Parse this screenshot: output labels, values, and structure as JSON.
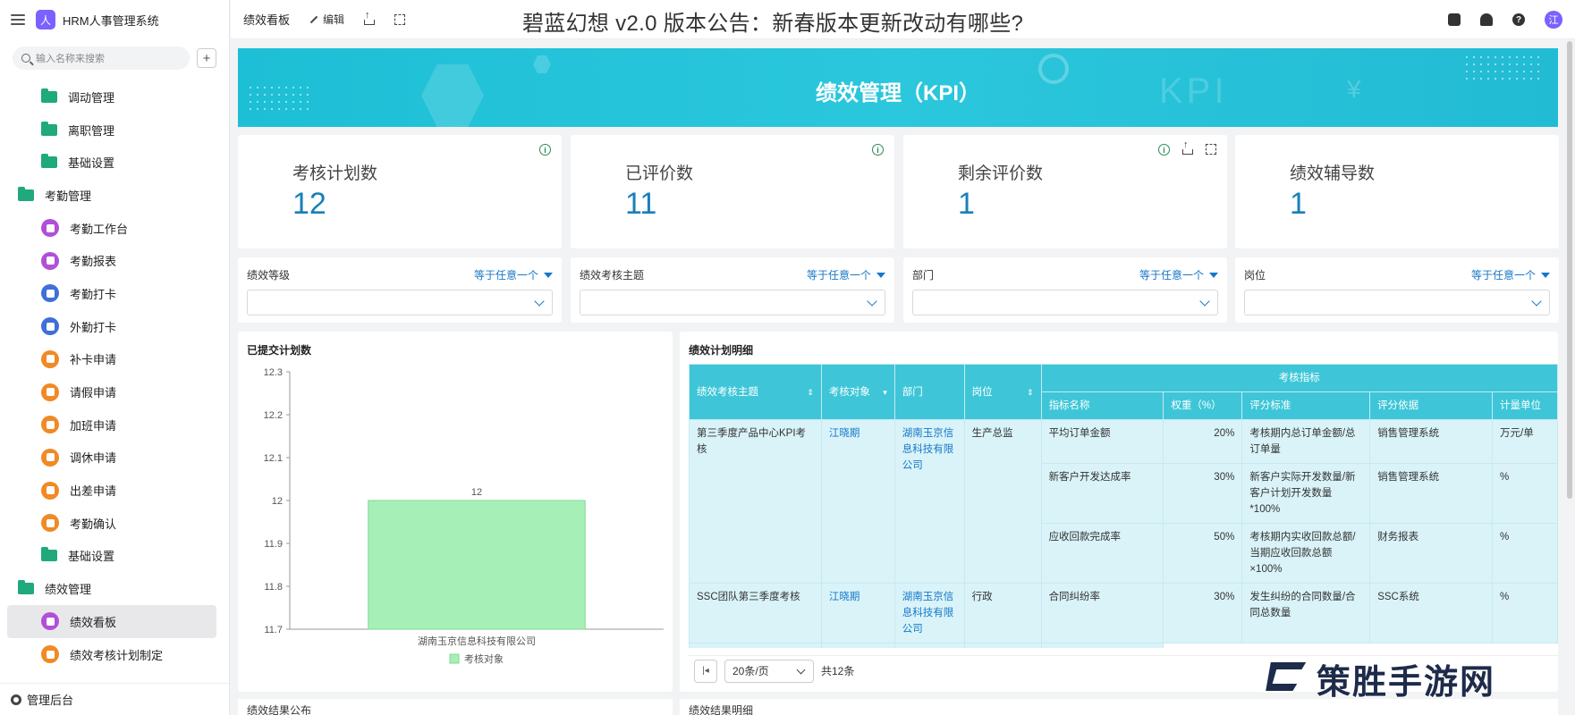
{
  "app": {
    "title": "HRM人事管理系统",
    "logo_char": "人",
    "brand_color": "#7b61ff"
  },
  "sidebar": {
    "search_placeholder": "输入名称来搜索",
    "items": [
      {
        "label": "调动管理",
        "icon": "folder-icon",
        "type": "child-folder"
      },
      {
        "label": "离职管理",
        "icon": "folder-icon",
        "type": "child-folder"
      },
      {
        "label": "基础设置",
        "icon": "folder-icon",
        "type": "child-folder"
      },
      {
        "label": "考勤管理",
        "icon": "folder-open-icon",
        "type": "group"
      },
      {
        "label": "考勤工作台",
        "icon": "purple-app-icon",
        "type": "child"
      },
      {
        "label": "考勤报表",
        "icon": "purple-app-icon",
        "type": "child"
      },
      {
        "label": "考勤打卡",
        "icon": "blue-doc-icon",
        "type": "child"
      },
      {
        "label": "外勤打卡",
        "icon": "blue-doc-icon",
        "type": "child"
      },
      {
        "label": "补卡申请",
        "icon": "orange-form-icon",
        "type": "child"
      },
      {
        "label": "请假申请",
        "icon": "orange-form-icon",
        "type": "child"
      },
      {
        "label": "加班申请",
        "icon": "orange-form-icon",
        "type": "child"
      },
      {
        "label": "调休申请",
        "icon": "orange-form-icon",
        "type": "child"
      },
      {
        "label": "出差申请",
        "icon": "orange-form-icon",
        "type": "child"
      },
      {
        "label": "考勤确认",
        "icon": "orange-form-icon",
        "type": "child"
      },
      {
        "label": "基础设置",
        "icon": "folder-icon",
        "type": "child-folder"
      },
      {
        "label": "绩效管理",
        "icon": "folder-open-icon",
        "type": "group"
      },
      {
        "label": "绩效看板",
        "icon": "purple-app-icon",
        "type": "child",
        "active": true
      },
      {
        "label": "绩效考核计划制定",
        "icon": "orange-form-icon",
        "type": "child"
      }
    ],
    "footer_label": "管理后台"
  },
  "topbar": {
    "page_title": "绩效看板",
    "edit_label": "编辑",
    "headline": "碧蓝幻想 v2.0 版本公告：新春版本更新改动有哪些?",
    "avatar_text": "江"
  },
  "banner": {
    "title": "绩效管理（KPI）",
    "bg_text": "KPI",
    "bg_symbol": "¥"
  },
  "stats": [
    {
      "label": "考核计划数",
      "value": "12"
    },
    {
      "label": "已评价数",
      "value": "11"
    },
    {
      "label": "剩余评价数",
      "value": "1"
    },
    {
      "label": "绩效辅导数",
      "value": "1"
    }
  ],
  "filters": [
    {
      "label": "绩效等级",
      "operator": "等于任意一个"
    },
    {
      "label": "绩效考核主题",
      "operator": "等于任意一个"
    },
    {
      "label": "部门",
      "operator": "等于任意一个"
    },
    {
      "label": "岗位",
      "operator": "等于任意一个"
    }
  ],
  "chart_panel": {
    "title": "已提交计划数"
  },
  "chart_data": {
    "type": "bar",
    "title": "已提交计划数",
    "categories": [
      "湖南玉京信息科技有限公司"
    ],
    "series": [
      {
        "name": "考核对象",
        "values": [
          12
        ],
        "color": "#a6f0b8"
      }
    ],
    "data_labels": [
      "12"
    ],
    "ylim": [
      11.7,
      12.3
    ],
    "yticks": [
      "12.3",
      "12.2",
      "12.1",
      "12",
      "11.9",
      "11.8",
      "11.7"
    ],
    "grid": false,
    "legend": "bottom"
  },
  "table_panel": {
    "title": "绩效计划明细",
    "group_header": "考核指标",
    "columns": [
      "绩效考核主题",
      "考核对象",
      "部门",
      "岗位",
      "指标名称",
      "权重（%）",
      "评分标准",
      "评分依据",
      "计量单位"
    ],
    "rows": [
      {
        "topic": "第三季度产品中心KPI考核",
        "target": "江晓期",
        "dept": "湖南玉京信息科技有限公司",
        "post": "生产总监",
        "indicators": [
          {
            "name": "平均订单金额",
            "weight": "20%",
            "standard": "考核期内总订单金额/总订单量",
            "basis": "销售管理系统",
            "unit": "万元/单"
          },
          {
            "name": "新客户开发达成率",
            "weight": "30%",
            "standard": "新客户实际开发数量/新客户计划开发数量*100%",
            "basis": "销售管理系统",
            "unit": "%"
          },
          {
            "name": "应收回款完成率",
            "weight": "50%",
            "standard": "考核期内实收回款总额/当期应收回款总额×100%",
            "basis": "财务报表",
            "unit": "%"
          }
        ]
      },
      {
        "topic": "SSC团队第三季度考核",
        "target": "江晓期",
        "dept": "湖南玉京信息科技有限公司",
        "post": "行政",
        "indicators": [
          {
            "name": "合同纠纷率",
            "weight": "30%",
            "standard": "发生纠纷的合同数量/合同总数量",
            "basis": "SSC系统",
            "unit": "%"
          }
        ]
      }
    ],
    "page_size": "20条/页",
    "total": "共12条"
  },
  "bottom_panels": [
    "绩效结果公布",
    "绩效结果明细"
  ],
  "watermark": {
    "text": "策胜手游网"
  }
}
